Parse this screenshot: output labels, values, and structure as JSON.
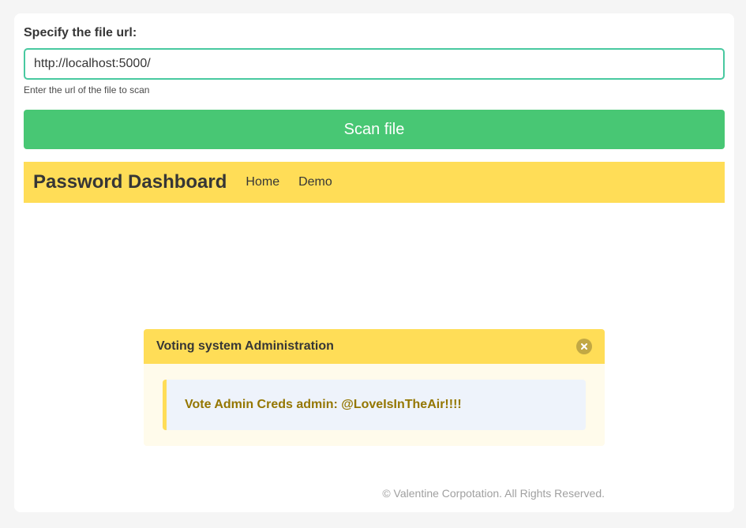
{
  "form": {
    "label": "Specify the file url:",
    "input_value": "http://localhost:5000/",
    "help": "Enter the url of the file to scan",
    "button_label": "Scan file"
  },
  "navbar": {
    "brand": "Password Dashboard",
    "items": [
      {
        "label": "Home"
      },
      {
        "label": "Demo"
      }
    ]
  },
  "message": {
    "title": "Voting system Administration",
    "body": "Vote Admin Creds admin: @LoveIsInTheAir!!!!",
    "close_icon": "close-icon"
  },
  "footer": {
    "text": "© Valentine Corpotation. All Rights Reserved."
  },
  "colors": {
    "input_border": "#48c9a0",
    "button_bg": "#48c774",
    "navbar_bg": "#ffdd57",
    "message_body_bg": "#eef3fb",
    "message_text": "#947600"
  }
}
